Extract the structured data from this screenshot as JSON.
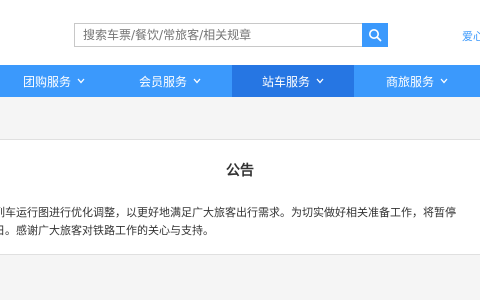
{
  "search": {
    "placeholder": "搜索车票/餐饮/常旅客/相关规章"
  },
  "header": {
    "right_link": "爱心"
  },
  "nav": {
    "items": [
      {
        "label": "团购服务"
      },
      {
        "label": "会员服务"
      },
      {
        "label": "站车服务"
      },
      {
        "label": "商旅服务"
      }
    ],
    "active_index": 2
  },
  "notice": {
    "title": "公告",
    "line1": "列车运行图进行优化调整，以更好地满足广大旅客出行需求。为切实做好相关准备工作，将暂停",
    "line2": "日。感谢广大旅客对铁路工作的关心与支持。"
  },
  "colors": {
    "primary": "#3b99fc",
    "active": "#2676e3"
  },
  "icons": {
    "search": "search-icon",
    "chevron": "chevron-down-icon"
  }
}
